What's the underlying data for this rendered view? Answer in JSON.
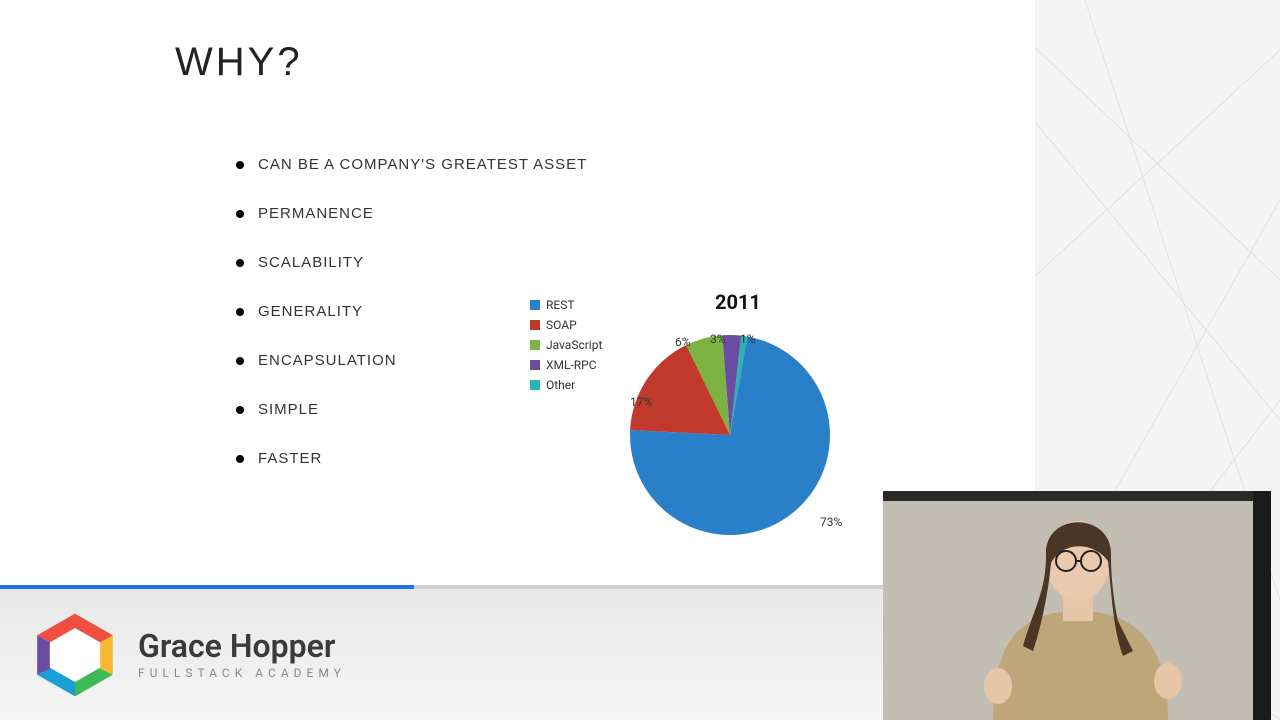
{
  "slide": {
    "title": "WHY?",
    "bullets": [
      "CAN BE A COMPANY'S GREATEST ASSET",
      "PERMANENCE",
      "SCALABILITY",
      "GENERALITY",
      "ENCAPSULATION",
      "SIMPLE",
      "FASTER"
    ]
  },
  "chart_data": {
    "type": "pie",
    "title": "2011",
    "series": [
      {
        "name": "REST",
        "value": 73,
        "color": "#2a7fc9",
        "label": "73%"
      },
      {
        "name": "SOAP",
        "value": 17,
        "color": "#c0392b",
        "label": "17%"
      },
      {
        "name": "JavaScript",
        "value": 6,
        "color": "#7cb342",
        "label": "6%"
      },
      {
        "name": "XML-RPC",
        "value": 3,
        "color": "#6a4ca3",
        "label": "3%"
      },
      {
        "name": "Other",
        "value": 1,
        "color": "#29b6b0",
        "label": "1%"
      }
    ]
  },
  "brand": {
    "name": "Grace Hopper",
    "sub": "FULLSTACK ACADEMY"
  },
  "progress_pct": 40
}
